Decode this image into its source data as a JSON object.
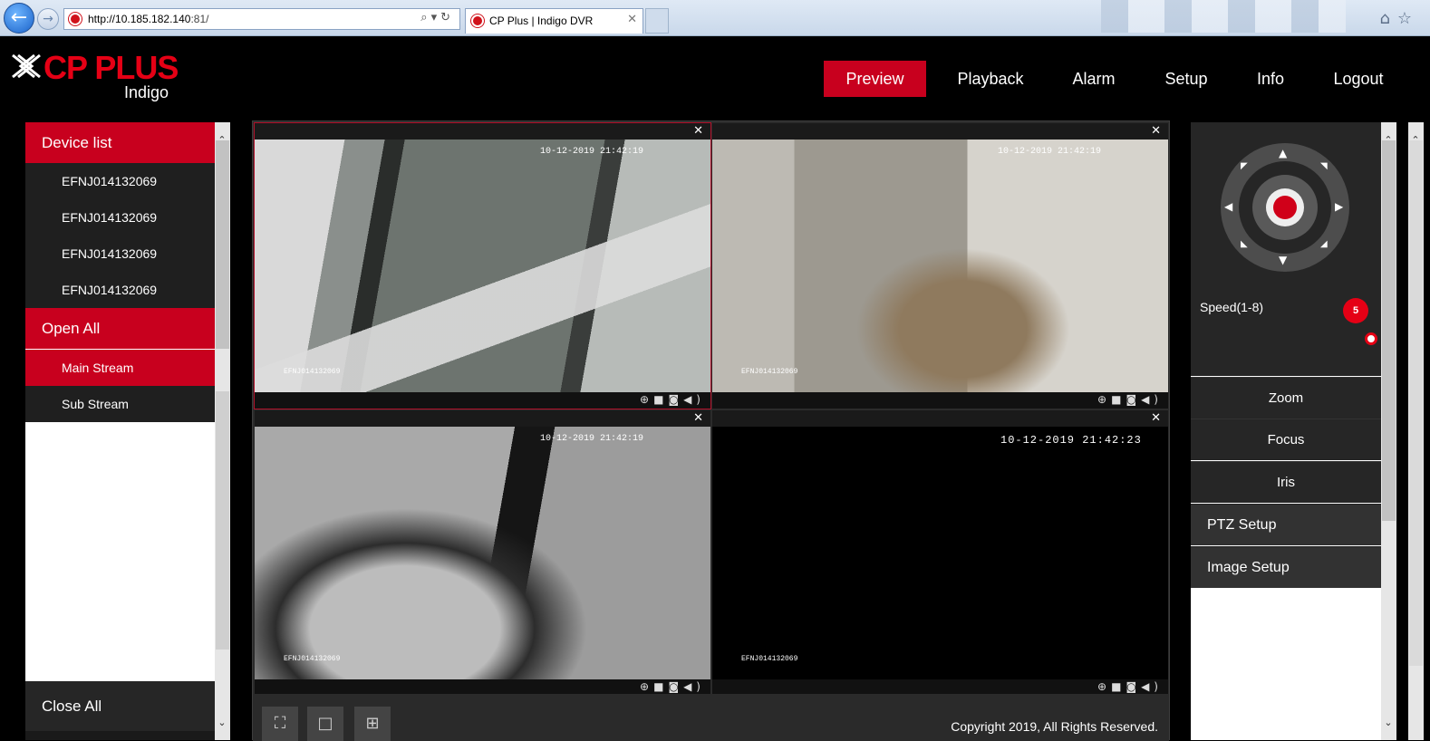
{
  "browser": {
    "url_host": "http://10.185.182.140",
    "url_port": ":81/",
    "tab_title": "CP Plus | Indigo DVR",
    "tab_close": "✕",
    "back_icon": "←",
    "forward_icon": "→",
    "addr_tools": "⌕▾↻",
    "chrome_icons": "⌂☆"
  },
  "brand": {
    "name": "CP PLUS",
    "subname": "Indigo",
    "accent": "#c8001e"
  },
  "menu": [
    {
      "label": "Preview",
      "active": true
    },
    {
      "label": "Playback"
    },
    {
      "label": "Alarm"
    },
    {
      "label": "Setup"
    },
    {
      "label": "Info"
    },
    {
      "label": "Logout"
    }
  ],
  "left": {
    "device_list": "Device list",
    "devices": [
      "EFNJ014132069",
      "EFNJ014132069",
      "EFNJ014132069",
      "EFNJ014132069"
    ],
    "open_all": "Open All",
    "streams": [
      "Main Stream",
      "Sub Stream"
    ],
    "close_all": "Close All"
  },
  "cells": [
    {
      "stamp": "10-12-2019 21:42:19",
      "label": "EFNJ014132069"
    },
    {
      "stamp": "10-12-2019 21:42:19",
      "label": "EFNJ014132069"
    },
    {
      "stamp": "10-12-2019 21:42:19",
      "label": "EFNJ014132069"
    },
    {
      "stamp": "10-12-2019 21:42:23",
      "label": "EFNJ014132069"
    }
  ],
  "cell_icons": {
    "close": "✕",
    "controls": "⊕■◙◀)"
  },
  "bottom": {
    "fullscreen": "⛶",
    "single": "□",
    "quad": "⊞",
    "copyright": "Copyright 2019, All Rights Reserved."
  },
  "ptz": {
    "speed_label": "Speed(1-8)",
    "speed_value": "5",
    "zoom": "Zoom",
    "focus": "Focus",
    "iris": "Iris",
    "ptz_setup": "PTZ Setup",
    "image_setup": "Image Setup",
    "arrows": {
      "up": "▲",
      "down": "▼",
      "left": "◀",
      "right": "▶",
      "ul": "◤",
      "ur": "◥",
      "dl": "◣",
      "dr": "◢"
    }
  },
  "scroll": {
    "up": "⌃",
    "down": "⌄"
  }
}
